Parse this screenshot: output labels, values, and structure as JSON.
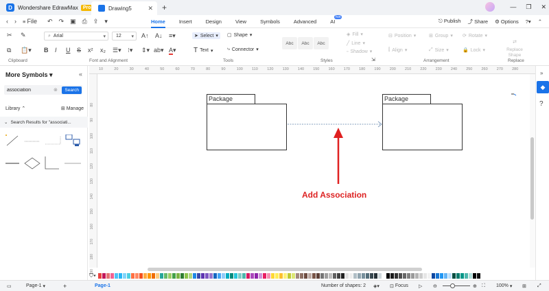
{
  "app": {
    "name": "Wondershare EdrawMax",
    "badge": "Pro",
    "doc_tab": "Drawing5",
    "logo_letter": "D"
  },
  "menu": {
    "file_label": "File",
    "tabs": [
      {
        "label": "Home",
        "active": true
      },
      {
        "label": "Insert"
      },
      {
        "label": "Design"
      },
      {
        "label": "View"
      },
      {
        "label": "Symbols"
      },
      {
        "label": "Advanced"
      },
      {
        "label": "AI",
        "badge": "hot"
      }
    ],
    "publish": "Publish",
    "share": "Share",
    "options": "Options"
  },
  "ribbon": {
    "font_name": "Arial",
    "font_size": "12",
    "select_label": "Select",
    "shape_label": "Shape",
    "text_label": "Text",
    "connector_label": "Connector",
    "fill_label": "Fill",
    "line_label": "Line",
    "shadow_label": "Shadow",
    "position_label": "Position",
    "group_label": "Group",
    "rotate_label": "Rotate",
    "align_label": "Align",
    "size_label": "Size",
    "lock_label": "Lock",
    "replace_shape_label": "Replace Shape",
    "style_samples": [
      "Abc",
      "Abc",
      "Abc"
    ],
    "groups": {
      "clipboard": "Clipboard",
      "font": "Font and Alignment",
      "tools": "Tools",
      "styles": "Styles",
      "arrangement": "Arrangement",
      "replace": "Replace"
    }
  },
  "left_panel": {
    "title": "More Symbols",
    "search_value": "association",
    "search_button": "Search",
    "library_label": "Library",
    "manage_label": "Manage",
    "results_label": "Search Results for  \"associati..."
  },
  "rulers": {
    "top": [
      "10",
      "20",
      "30",
      "40",
      "50",
      "60",
      "70",
      "80",
      "90",
      "100",
      "110",
      "120",
      "130",
      "140",
      "150",
      "160",
      "170",
      "180",
      "190",
      "200",
      "210",
      "220",
      "230",
      "240",
      "250",
      "260",
      "270",
      "280"
    ],
    "left": [
      "80",
      "90",
      "100",
      "110",
      "120",
      "130",
      "140",
      "150",
      "160",
      "170",
      "180",
      "190"
    ]
  },
  "canvas": {
    "package1_label": "Package",
    "package2_label": "Package",
    "annotation": "Add Association"
  },
  "status": {
    "page_select": "Page-1",
    "page_tab": "Page-1",
    "shapes_count": "Number of shapes: 2",
    "focus_label": "Focus",
    "zoom": "100%"
  },
  "palette_colors": [
    "#e8423f",
    "#c2185b",
    "#e57373",
    "#f06292",
    "#4fc3f7",
    "#29b6f6",
    "#81d4fa",
    "#4dd0e1",
    "#ff7043",
    "#ff8a65",
    "#f4511e",
    "#ffab40",
    "#ff9800",
    "#ef6c00",
    "#ffcc80",
    "#26a69a",
    "#66bb6a",
    "#9ccc65",
    "#43a047",
    "#7cb342",
    "#2e7d32",
    "#8bc34a",
    "#aed581",
    "#1e88e5",
    "#3949ab",
    "#5e35b1",
    "#7e57c2",
    "#9575cd",
    "#1565c0",
    "#42a5f5",
    "#90caf9",
    "#00acc1",
    "#00897b",
    "#26c6da",
    "#80cbc4",
    "#4db6ac",
    "#d81b60",
    "#ab47bc",
    "#8e24aa",
    "#ce93d8",
    "#e91e63",
    "#f48fb1",
    "#fdd835",
    "#ffee58",
    "#fbc02d",
    "#fff176",
    "#c0ca33",
    "#dce775",
    "#a1887f",
    "#8d6e63",
    "#6d4c41",
    "#bcaaa4",
    "#795548",
    "#5d4037",
    "#757575",
    "#9e9e9e",
    "#bdbdbd",
    "#616161",
    "#424242",
    "#212121",
    "#e0e0e0",
    "#eeeeee",
    "#b0bec5",
    "#90a4ae",
    "#78909c",
    "#546e7a",
    "#37474f",
    "#263238",
    "#cfd8dc",
    "#ffffff",
    "#000000",
    "#1a1a1a",
    "#333333",
    "#4d4d4d",
    "#666666",
    "#808080",
    "#999999",
    "#b3b3b3",
    "#cccccc",
    "#e6e6e6",
    "#f2f2f2",
    "#0d47a1",
    "#1976d2",
    "#2196f3",
    "#64b5f6",
    "#bbdefb",
    "#004d40",
    "#00796b",
    "#009688",
    "#4db6ac",
    "#b2dfdb",
    "#000000",
    "#111111"
  ]
}
